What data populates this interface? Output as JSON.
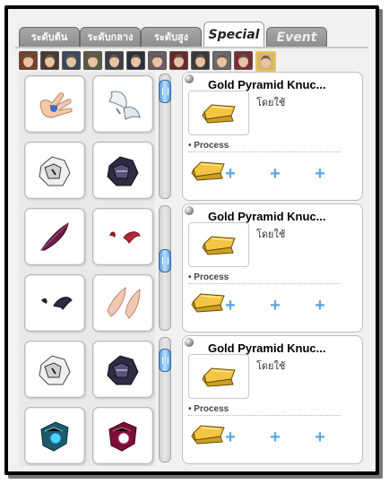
{
  "tabs": [
    {
      "label": "ระดับต้น"
    },
    {
      "label": "ระดับกลาง"
    },
    {
      "label": "ระดับสูง"
    },
    {
      "label": "Special",
      "active": true
    },
    {
      "label": "Event"
    }
  ],
  "avatars": [
    {
      "name": "character-1",
      "color": "#7b3f2a"
    },
    {
      "name": "character-2",
      "color": "#4a3b32"
    },
    {
      "name": "character-3",
      "color": "#3c4a5e"
    },
    {
      "name": "character-4",
      "color": "#5b5b3e"
    },
    {
      "name": "character-5",
      "color": "#3e3e48"
    },
    {
      "name": "character-6",
      "color": "#2b2f3c"
    },
    {
      "name": "character-7",
      "color": "#6c5a64"
    },
    {
      "name": "character-8",
      "color": "#6b2a2a"
    },
    {
      "name": "character-9",
      "color": "#3a3a3a"
    },
    {
      "name": "character-10",
      "color": "#6b6a6a"
    },
    {
      "name": "character-11",
      "color": "#7a2d36"
    },
    {
      "name": "character-12",
      "color": "#d7b56a",
      "active": true
    }
  ],
  "left_items": [
    {
      "icon": "hand-tattoo-icon"
    },
    {
      "icon": "white-wing-icon"
    },
    {
      "icon": "white-armor-icon"
    },
    {
      "icon": "dark-armor-icon"
    },
    {
      "icon": "purple-feather-icon"
    },
    {
      "icon": "red-wings-icon"
    },
    {
      "icon": "bat-wings-icon"
    },
    {
      "icon": "elf-ears-icon"
    },
    {
      "icon": "white-armor-icon"
    },
    {
      "icon": "dark-armor-icon"
    },
    {
      "icon": "blue-gauntlet-icon"
    },
    {
      "icon": "red-gauntlet-icon"
    }
  ],
  "panels": [
    {
      "title": "Gold Pyramid Knuc...",
      "status": "โดยใช้",
      "process_label": "• Process",
      "item_icon": "gold-bar-icon"
    },
    {
      "title": "Gold Pyramid Knuc...",
      "status": "โดยใช้",
      "process_label": "• Process",
      "item_icon": "gold-bar-icon"
    },
    {
      "title": "Gold Pyramid Knuc...",
      "status": "โดยใช้",
      "process_label": "• Process",
      "item_icon": "gold-bar-icon"
    }
  ],
  "plus_symbol": "+"
}
